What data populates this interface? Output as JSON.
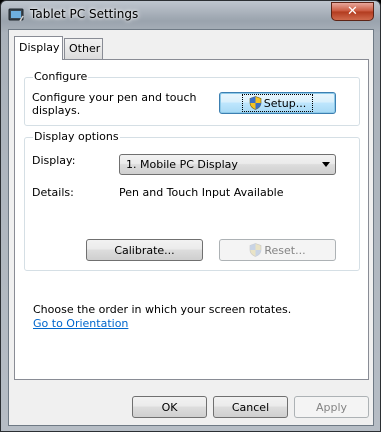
{
  "window": {
    "title": "Tablet PC Settings",
    "close_label": "✕"
  },
  "tabs": [
    {
      "label": "Display",
      "active": true
    },
    {
      "label": "Other",
      "active": false
    }
  ],
  "configure": {
    "group_label": "Configure",
    "description": "Configure your pen and touch displays.",
    "setup_button": "Setup..."
  },
  "display_options": {
    "group_label": "Display options",
    "display_label": "Display:",
    "display_value": "1. Mobile PC Display",
    "details_label": "Details:",
    "details_value": "Pen and Touch Input Available",
    "calibrate_button": "Calibrate...",
    "reset_button": "Reset..."
  },
  "orientation": {
    "description": "Choose the order in which your screen rotates.",
    "link": "Go to Orientation"
  },
  "footer": {
    "ok_button": "OK",
    "cancel_button": "Cancel",
    "apply_button": "Apply"
  },
  "icons": {
    "app": "tablet-pc-icon",
    "close": "close-icon",
    "uac_shield": "uac-shield-icon",
    "dropdown": "chevron-down-icon"
  },
  "colors": {
    "link": "#0066cc",
    "focus_blue": "#3c7fb1",
    "close_red": "#c9583e",
    "disabled_text": "#838383"
  }
}
